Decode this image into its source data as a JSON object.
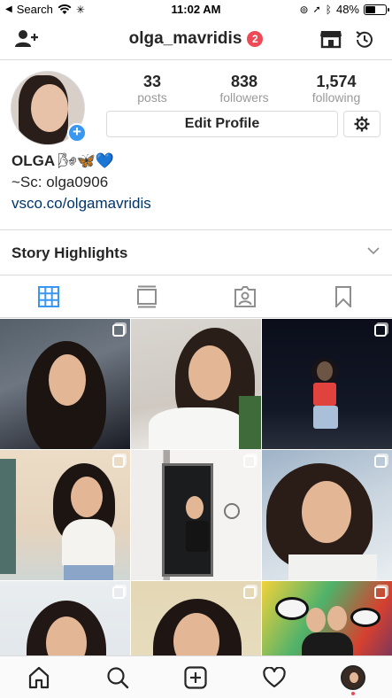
{
  "status_bar": {
    "carrier": "Search",
    "time": "11:02 AM",
    "battery": "48%",
    "battery_level": 0.48
  },
  "header": {
    "username": "olga_mavridis",
    "notification_count": "2",
    "icons": [
      "add-user-icon",
      "shop-icon",
      "archive-icon"
    ]
  },
  "profile": {
    "stats": [
      {
        "value": "33",
        "label": "posts"
      },
      {
        "value": "838",
        "label": "followers"
      },
      {
        "value": "1,574",
        "label": "following"
      }
    ],
    "edit_button": "Edit Profile",
    "name": "OLGA",
    "name_emojis": "🌬🦋💙",
    "bio_line": "~Sc: olga0906",
    "website": "vsco.co/olgamavridis"
  },
  "highlights": {
    "label": "Story Highlights"
  },
  "tabs": [
    "grid-icon",
    "feed-icon",
    "tagged-icon",
    "saved-icon"
  ],
  "grid": [
    {
      "multi": true
    },
    {
      "multi": false
    },
    {
      "multi": true
    },
    {
      "multi": true
    },
    {
      "multi": true
    },
    {
      "multi": true
    },
    {
      "multi": true
    },
    {
      "multi": true
    },
    {
      "multi": true
    }
  ],
  "bottom_nav": [
    "home-icon",
    "search-icon",
    "new-post-icon",
    "activity-icon",
    "profile-avatar"
  ],
  "colors": {
    "badge": "#ed4956",
    "accent_blue": "#3897f0",
    "link": "#003569",
    "active_tab": "#3897f0"
  }
}
